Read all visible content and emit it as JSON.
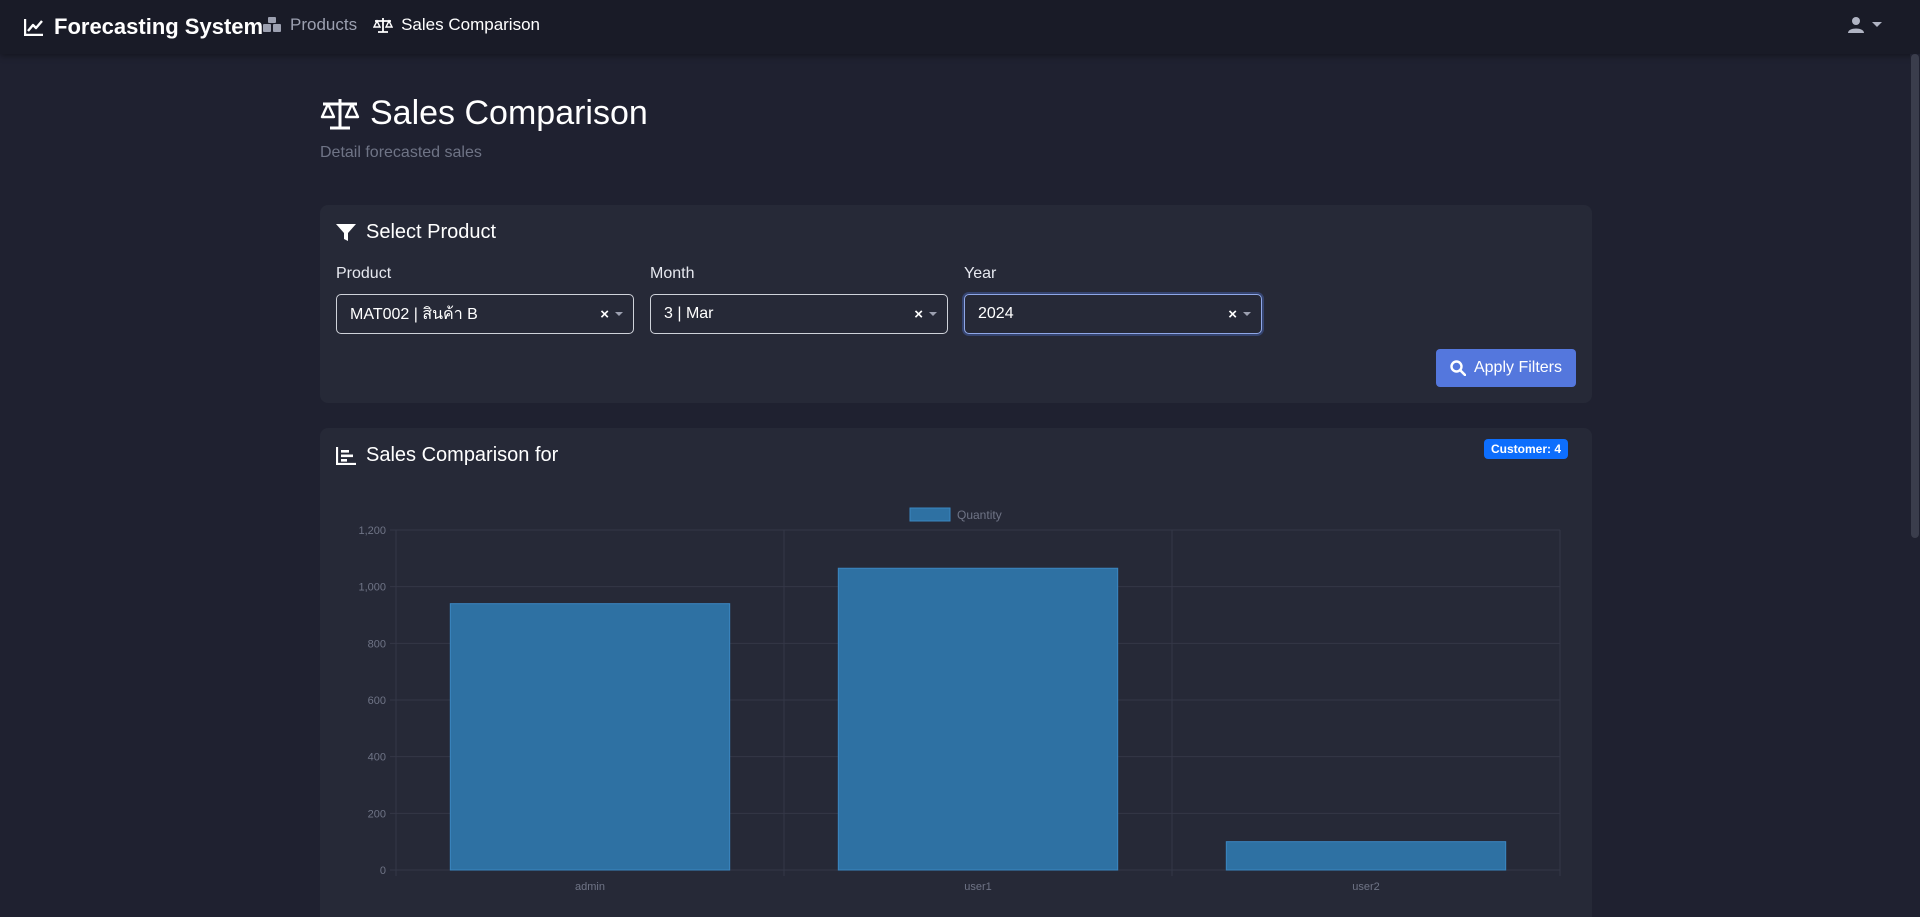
{
  "navbar": {
    "brand": "Forecasting System",
    "links": [
      {
        "label": "Products",
        "icon": "boxes-icon",
        "active": false
      },
      {
        "label": "Sales Comparison",
        "icon": "balance-scale-icon",
        "active": true
      }
    ],
    "user_icon": "user-icon"
  },
  "page": {
    "title": "Sales Comparison",
    "subtitle": "Detail forecasted sales"
  },
  "filters": {
    "header": "Select Product",
    "product": {
      "label": "Product",
      "value": "MAT002 | สินค้า B"
    },
    "month": {
      "label": "Month",
      "value": "3 | Mar"
    },
    "year": {
      "label": "Year",
      "value": "2024"
    },
    "apply_label": "Apply Filters"
  },
  "chart_card": {
    "header": "Sales Comparison for",
    "badge": "Customer: 4"
  },
  "colors": {
    "accent": "#5477dd",
    "badge": "#0d6efd",
    "bar": "#2e71a3",
    "bar_border": "#3b86c0"
  },
  "chart_data": {
    "type": "bar",
    "categories": [
      "admin",
      "user1",
      "user2"
    ],
    "series": [
      {
        "name": "Quantity",
        "values": [
          940,
          1065,
          100
        ]
      }
    ],
    "yticks": [
      "0",
      "200",
      "400",
      "600",
      "800",
      "1,000",
      "1,200"
    ],
    "ylim": [
      0,
      1200
    ],
    "grid": true,
    "legend": "top-center"
  }
}
